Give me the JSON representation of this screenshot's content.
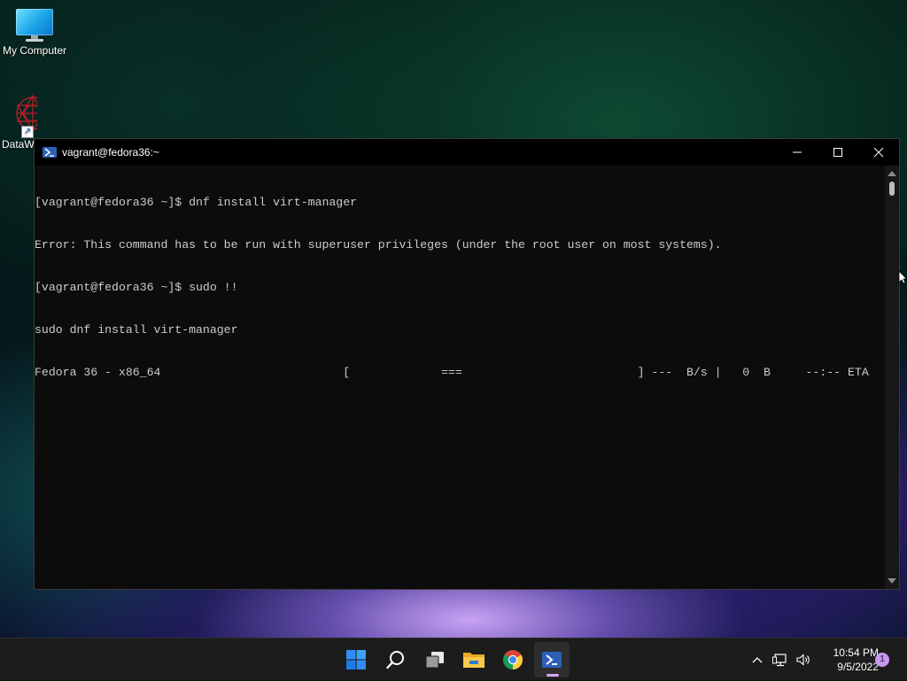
{
  "desktop": {
    "icons": [
      {
        "label": "My Computer"
      },
      {
        "label": "DataW"
      }
    ]
  },
  "window": {
    "title": "vagrant@fedora36:~",
    "lines": [
      "[vagrant@fedora36 ~]$ dnf install virt-manager",
      "Error: This command has to be run with superuser privileges (under the root user on most systems).",
      "[vagrant@fedora36 ~]$ sudo !!",
      "sudo dnf install virt-manager",
      "Fedora 36 - x86_64                          [             ===                         ] ---  B/s |   0  B     --:-- ETA"
    ]
  },
  "taskbar": {
    "apps": [
      "start-icon",
      "search-icon",
      "task-view-icon",
      "file-explorer-icon",
      "chrome-icon",
      "terminal-icon"
    ],
    "clock": {
      "time": "10:54 PM",
      "date": "9/5/2022"
    },
    "notifications": "1"
  },
  "colors": {
    "terminal_bg": "#0c0c0c",
    "terminal_fg": "#cccccc",
    "taskbar_bg": "#1c1c1c",
    "accent": "#d7a6f5"
  }
}
